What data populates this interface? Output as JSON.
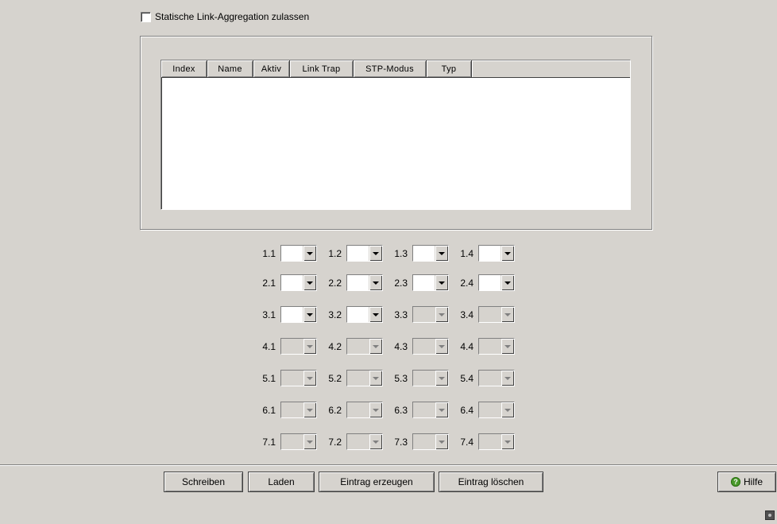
{
  "static_link_aggregation": {
    "label": "Statische Link-Aggregation zulassen",
    "checked": false
  },
  "table": {
    "columns": [
      "Index",
      "Name",
      "Aktiv",
      "Link Trap",
      "STP-Modus",
      "Typ"
    ],
    "rows": []
  },
  "ports": [
    [
      {
        "label": "1.1",
        "enabled": true
      },
      {
        "label": "1.2",
        "enabled": true
      },
      {
        "label": "1.3",
        "enabled": true
      },
      {
        "label": "1.4",
        "enabled": true
      }
    ],
    [
      {
        "label": "2.1",
        "enabled": true
      },
      {
        "label": "2.2",
        "enabled": true
      },
      {
        "label": "2.3",
        "enabled": true
      },
      {
        "label": "2.4",
        "enabled": true
      }
    ],
    [
      {
        "label": "3.1",
        "enabled": true
      },
      {
        "label": "3.2",
        "enabled": true
      },
      {
        "label": "3.3",
        "enabled": false
      },
      {
        "label": "3.4",
        "enabled": false
      }
    ],
    [
      {
        "label": "4.1",
        "enabled": false
      },
      {
        "label": "4.2",
        "enabled": false
      },
      {
        "label": "4.3",
        "enabled": false
      },
      {
        "label": "4.4",
        "enabled": false
      }
    ],
    [
      {
        "label": "5.1",
        "enabled": false
      },
      {
        "label": "5.2",
        "enabled": false
      },
      {
        "label": "5.3",
        "enabled": false
      },
      {
        "label": "5.4",
        "enabled": false
      }
    ],
    [
      {
        "label": "6.1",
        "enabled": false
      },
      {
        "label": "6.2",
        "enabled": false
      },
      {
        "label": "6.3",
        "enabled": false
      },
      {
        "label": "6.4",
        "enabled": false
      }
    ],
    [
      {
        "label": "7.1",
        "enabled": false
      },
      {
        "label": "7.2",
        "enabled": false
      },
      {
        "label": "7.3",
        "enabled": false
      },
      {
        "label": "7.4",
        "enabled": false
      }
    ]
  ],
  "buttons": {
    "write": "Schreiben",
    "load": "Laden",
    "create": "Eintrag erzeugen",
    "delete": "Eintrag löschen",
    "help": "Hilfe"
  },
  "colors": {
    "background": "#d6d3ce",
    "help_icon": "#4a9a2a"
  }
}
